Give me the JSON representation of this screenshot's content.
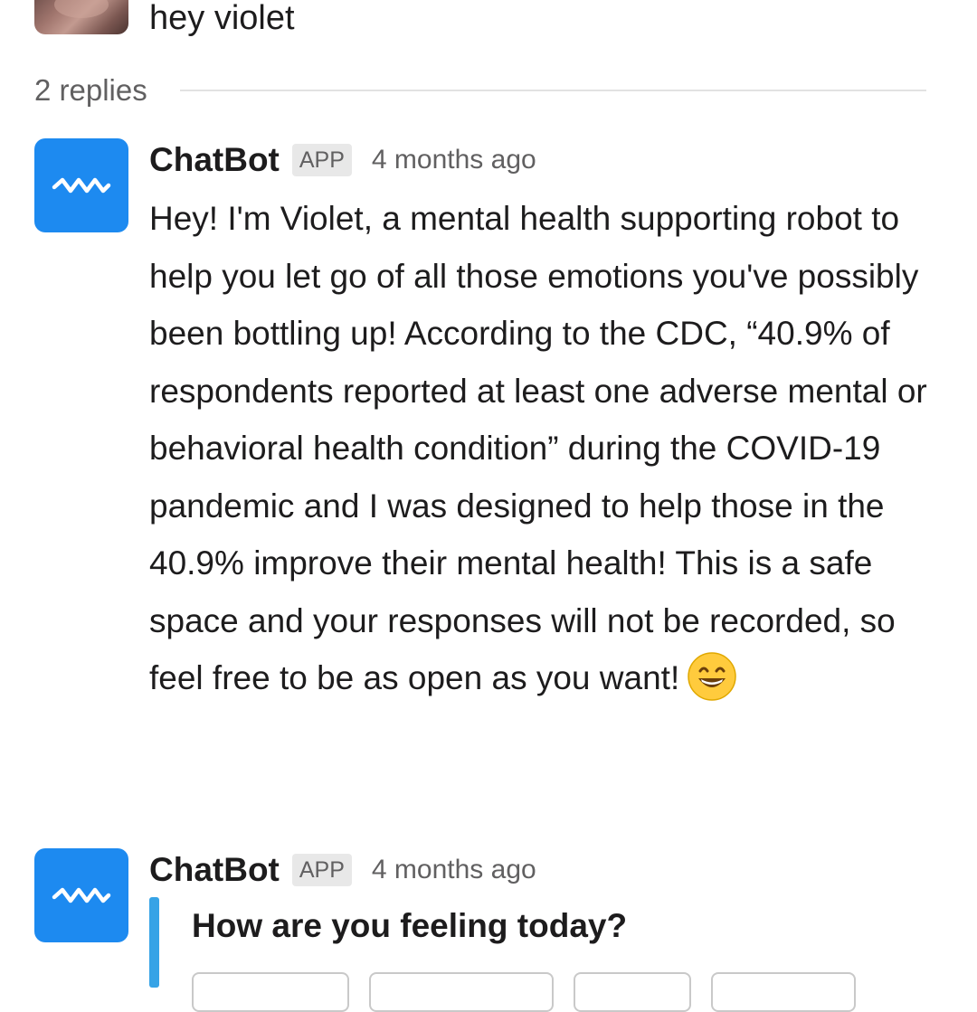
{
  "thread": {
    "user_message": "hey violet",
    "replies_label": "2 replies"
  },
  "messages": [
    {
      "sender": "ChatBot",
      "badge": "APP",
      "timestamp": "4 months ago",
      "text": "Hey! I'm Violet, a mental health supporting robot to help you let go of all those emotions you've possibly been bottling up! According to the CDC, “40.9% of respondents reported at least one adverse mental or behavioral health condition” during the COVID-19 pandemic and I was designed to help those in the 40.9% improve their mental health! This is a safe space and your responses will not be recorded, so feel free to be as open as you want!",
      "emoji": "grinning-face-with-smiling-eyes"
    },
    {
      "sender": "ChatBot",
      "badge": "APP",
      "timestamp": "4 months ago",
      "quote": "How are you feeling today?"
    }
  ],
  "colors": {
    "bot_avatar": "#1d8af0",
    "quote_bar": "#36a3e6",
    "muted_text": "#616061",
    "text": "#1d1c1d"
  },
  "icons": {
    "bot_avatar": "wave-icon",
    "user_avatar": "profile-photo"
  }
}
